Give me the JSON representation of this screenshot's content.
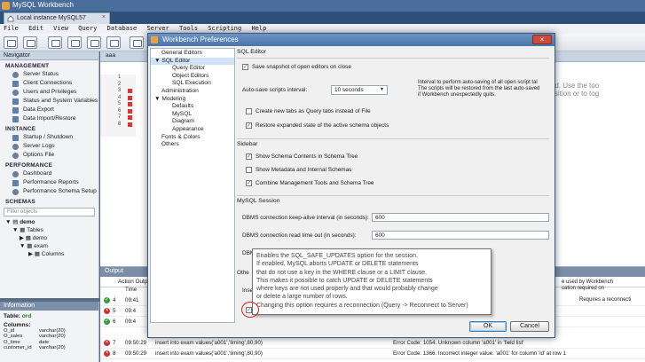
{
  "app": {
    "title": "MySQL Workbench",
    "tab": "Local instance MySQL57"
  },
  "menu": [
    "File",
    "Edit",
    "View",
    "Query",
    "Database",
    "Server",
    "Tools",
    "Scripting",
    "Help"
  ],
  "navigator": {
    "title": "Navigator",
    "management_title": "MANAGEMENT",
    "management": [
      "Server Status",
      "Client Connections",
      "Users and Privileges",
      "Status and System Variables",
      "Data Export",
      "Data Import/Restore"
    ],
    "instance_title": "INSTANCE",
    "instance": [
      "Startup / Shutdown",
      "Server Logs",
      "Options File"
    ],
    "performance_title": "PERFORMANCE",
    "performance": [
      "Dashboard",
      "Performance Reports",
      "Performance Schema Setup"
    ],
    "schemas_title": "SCHEMAS",
    "filter_placeholder": "Filter objects",
    "tree": [
      "demo",
      "Tables",
      "demo",
      "exam",
      "Columns"
    ]
  },
  "information": {
    "title": "Information",
    "table_label": "Table:",
    "table_name": "ord",
    "columns_label": "Columns:",
    "columns": [
      [
        "O_id",
        "varchar(20)"
      ],
      [
        "O_sales",
        "varchar(20)"
      ],
      [
        "O_time",
        "date"
      ],
      [
        "customer_id",
        "varchar(20)"
      ]
    ]
  },
  "editor": {
    "tab": "aaa",
    "lines": [
      "1",
      "2",
      "3",
      "4",
      "5",
      "6",
      "7",
      "8"
    ],
    "hint_line1": "disabled. Use the too",
    "hint_line2": "rent position or to tog"
  },
  "output": {
    "title": "Output",
    "subtitle": "Action Output",
    "col_time": "Time",
    "rows": [
      {
        "n": "4",
        "time": "09:41",
        "status": "ok",
        "action": "",
        "msg": ""
      },
      {
        "n": "5",
        "time": "09:4",
        "status": "err",
        "action": "",
        "msg": ""
      },
      {
        "n": "6",
        "time": "09:4",
        "status": "ok",
        "action": "",
        "msg": ""
      },
      {
        "n": "7",
        "time": "09:50:29",
        "status": "err",
        "action": "insert into exam values('a001','liming',80,90)",
        "msg": "Error Code: 1054. Unknown column 'a001' in 'field list'"
      },
      {
        "n": "8",
        "time": "09:50:29",
        "status": "err",
        "action": "insert into exam values('a001','liming',80,90)",
        "msg": "Error Code: 1366. Incorrect integer value: 'a001' for column 'id' at row 1"
      }
    ],
    "right_notes": [
      "e used by Workbench",
      "cation required on",
      "Requires a reconnecti"
    ]
  },
  "prefs": {
    "title": "Workbench Preferences",
    "sidebar": [
      {
        "label": "General Editors",
        "level": 0
      },
      {
        "label": "▼ SQL Editor",
        "level": -1,
        "selected": true
      },
      {
        "label": "Query Editor",
        "level": 1
      },
      {
        "label": "Object Editors",
        "level": 1
      },
      {
        "label": "SQL Execution",
        "level": 1
      },
      {
        "label": "Administration",
        "level": 0
      },
      {
        "label": "▼ Modeling",
        "level": -1
      },
      {
        "label": "Defaults",
        "level": 1
      },
      {
        "label": "MySQL",
        "level": 1
      },
      {
        "label": "Diagram",
        "level": 1
      },
      {
        "label": "Appearance",
        "level": 1
      },
      {
        "label": "Fonts & Colors",
        "level": 0
      },
      {
        "label": "Others",
        "level": 0
      }
    ],
    "group_sql_editor": "SQL Editor",
    "save_snapshot": "Save snapshot of open editors on close",
    "autosave_label": "Auto-save scripts interval:",
    "autosave_value": "10 seconds",
    "autosave_desc": [
      "Interval to perform auto-saving of all open script tal",
      "The scripts will be restored from the last auto-saved",
      "if Workbench unexpectedly quits."
    ],
    "new_tabs": "Create new tabs as Query tabs instead of File",
    "restore_expanded": "Restore expanded state of the active schema objects",
    "group_sidebar": "Sidebar",
    "show_schema": "Show Schema Contents in Schema Tree",
    "show_metadata": "Show Metadata and Internal Schemas",
    "combine_tools": "Combine Management Tools and Schema Tree",
    "group_session": "MySQL Session",
    "keepalive_label": "DBMS connection keep-alive interval (in seconds):",
    "keepalive_value": "600",
    "readtimeout_label": "DBMS connection read time out (in seconds):",
    "readtimeout_value": "600",
    "dbm_truncated": "DBM",
    "other_truncated": "Othe",
    "inse_truncated": "Inse",
    "ok": "OK",
    "cancel": "Cancel"
  },
  "tooltip": [
    "Enables the SQL_SAFE_UPDATES option for the session.",
    "If enabled, MySQL aborts UPDATE or DELETE statements",
    "that do not use a key in the WHERE clause or a LIMIT clause.",
    "This makes it possible to catch UPDATE or DELETE statements",
    "where keys are not used properly and that would probably change",
    "or delete a large number of rows.",
    "Changing this option requires a reconnection (Query -> Reconnect to Server)"
  ]
}
